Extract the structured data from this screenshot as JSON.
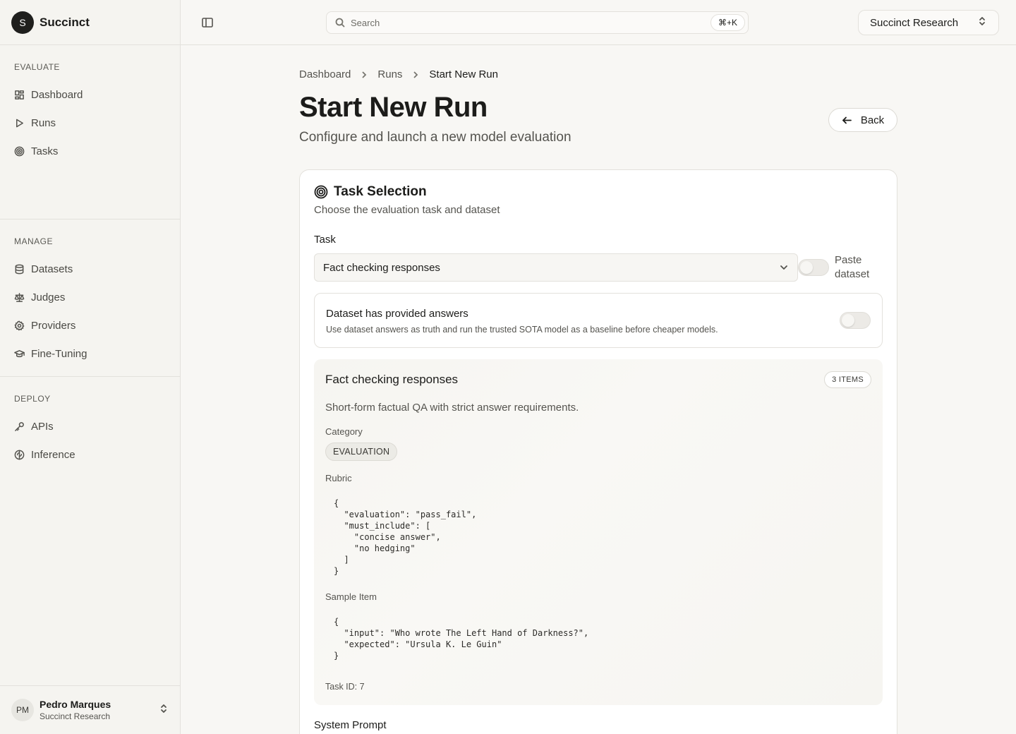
{
  "brand": {
    "logo_letter": "S",
    "name": "Succinct"
  },
  "sidebar": {
    "sections": [
      {
        "heading": "EVALUATE",
        "items": [
          {
            "label": "Dashboard",
            "icon": "dashboard-icon"
          },
          {
            "label": "Runs",
            "icon": "play-icon"
          },
          {
            "label": "Tasks",
            "icon": "target-icon"
          }
        ]
      },
      {
        "heading": "MANAGE",
        "items": [
          {
            "label": "Datasets",
            "icon": "database-icon"
          },
          {
            "label": "Judges",
            "icon": "scale-icon"
          },
          {
            "label": "Providers",
            "icon": "gear-icon"
          },
          {
            "label": "Fine-Tuning",
            "icon": "graduation-cap-icon"
          }
        ]
      },
      {
        "heading": "DEPLOY",
        "items": [
          {
            "label": "APIs",
            "icon": "key-icon"
          },
          {
            "label": "Inference",
            "icon": "brain-icon"
          }
        ]
      }
    ],
    "user": {
      "initials": "PM",
      "name": "Pedro Marques",
      "org": "Succinct Research"
    }
  },
  "topbar": {
    "search_placeholder": "Search",
    "search_shortcut": "⌘+K",
    "org_selector": "Succinct Research"
  },
  "breadcrumb": [
    "Dashboard",
    "Runs",
    "Start New Run"
  ],
  "page": {
    "title": "Start New Run",
    "subtitle": "Configure and launch a new model evaluation",
    "back_label": "Back"
  },
  "task_card": {
    "title": "Task Selection",
    "subtitle": "Choose the evaluation task and dataset",
    "task_label": "Task",
    "task_value": "Fact checking responses",
    "paste_label": "Paste dataset",
    "paste_enabled": false,
    "answers": {
      "title": "Dataset has provided answers",
      "description": "Use dataset answers as truth and run the trusted SOTA model as a baseline before cheaper models.",
      "enabled": false
    },
    "details": {
      "title": "Fact checking responses",
      "badge": "3 ITEMS",
      "description": "Short-form factual QA with strict answer requirements.",
      "category_label": "Category",
      "category": "EVALUATION",
      "rubric_label": "Rubric",
      "rubric": "{\n  \"evaluation\": \"pass_fail\",\n  \"must_include\": [\n    \"concise answer\",\n    \"no hedging\"\n  ]\n}",
      "sample_label": "Sample Item",
      "sample": "{\n  \"input\": \"Who wrote The Left Hand of Darkness?\",\n  \"expected\": \"Ursula K. Le Guin\"\n}",
      "task_id": "Task ID: 7"
    },
    "system_prompt_label": "System Prompt"
  }
}
